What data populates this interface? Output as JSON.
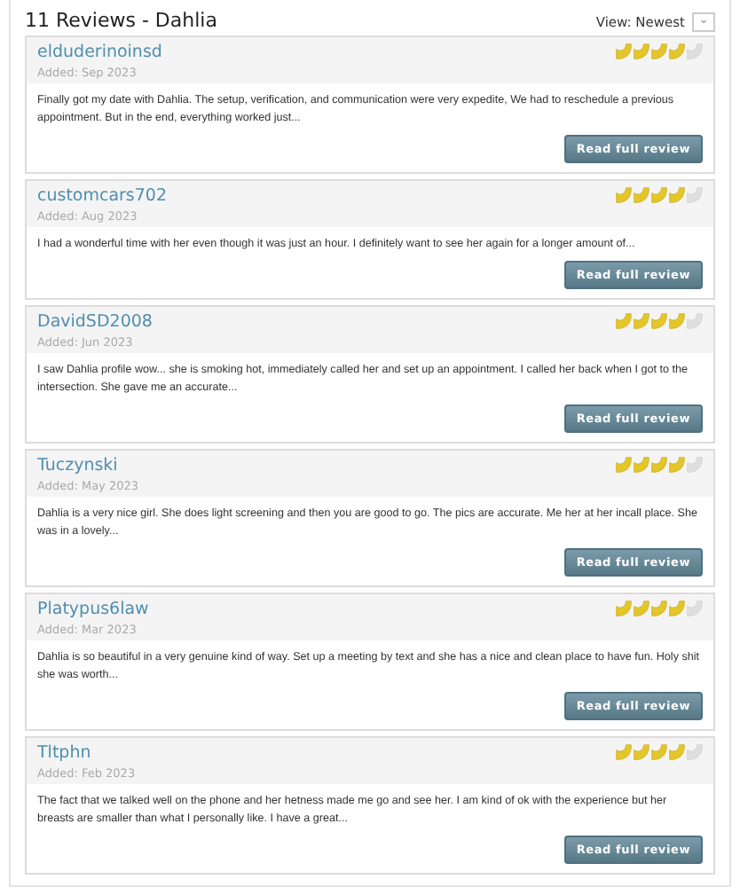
{
  "title": "11 Reviews - Dahlia",
  "view": {
    "label": "View: Newest",
    "control": "⌄"
  },
  "reviews": [
    {
      "author": "elduderinoinsd",
      "added": "Added: Sep 2023",
      "stars": 4,
      "text": "Finally got my date with Dahlia. The setup, verification, and communication were very expedite, We had to reschedule a previous appointment. But in the end, everything worked just...",
      "button": "Read full review"
    },
    {
      "author": "customcars702",
      "added": "Added: Aug 2023",
      "stars": 4,
      "text": "I had a wonderful time with her even though it was just an hour. I definitely want to see her again for a longer amount of...",
      "button": "Read full review"
    },
    {
      "author": "DavidSD2008",
      "added": "Added: Jun 2023",
      "stars": 4,
      "text": "I saw Dahlia profile wow... she is smoking hot, immediately called her and set up an appointment. I called her back when I got to the intersection. She gave me an accurate...",
      "button": "Read full review"
    },
    {
      "author": "Tuczynski",
      "added": "Added: May 2023",
      "stars": 4,
      "text": "Dahlia is a very nice girl. She does light screening and then you are good to go. The pics are accurate. Me her at her incall place. She was in a lovely...",
      "button": "Read full review"
    },
    {
      "author": "Platypus6law",
      "added": "Added: Mar 2023",
      "stars": 4,
      "text": "Dahlia is so beautiful in a very genuine kind of way. Set up a meeting by text and she has a nice and clean place to have fun. Holy shit she was worth...",
      "button": "Read full review"
    },
    {
      "author": "Tltphn",
      "added": "Added: Feb 2023",
      "stars": 4,
      "text": "The fact that we talked well on the phone and her hetness made me go and see her. I am kind of ok with the experience but her breasts are smaller than what I personally like. I have a great...",
      "button": "Read full review"
    }
  ]
}
